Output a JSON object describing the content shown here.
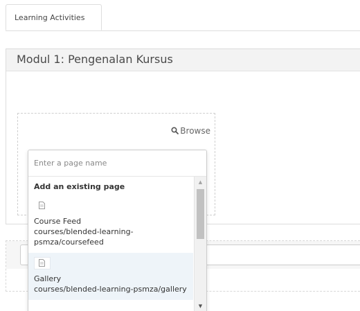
{
  "tabs": [
    {
      "label": "Learning Activities",
      "active": true
    }
  ],
  "module": {
    "title": "Modul 1: Pengenalan Kursus"
  },
  "dropzone": {
    "browse_label": "Browse",
    "browse_icon": "search-icon"
  },
  "page_picker": {
    "placeholder": "Enter a page name",
    "value": "",
    "group_label": "Add an existing page",
    "options": [
      {
        "icon": "page-icon",
        "name": "Course Feed",
        "path": "courses/blended-learning-psmza/coursefeed",
        "highlighted": false
      },
      {
        "icon": "page-icon",
        "name": "Gallery",
        "path": "courses/blended-learning-psmza/gallery",
        "highlighted": true
      }
    ],
    "scrollbar": {
      "position": 0.0
    }
  },
  "colors": {
    "highlight": "#eef4f9",
    "header_bg": "#f3f3f3",
    "border": "#dcdcdc"
  }
}
